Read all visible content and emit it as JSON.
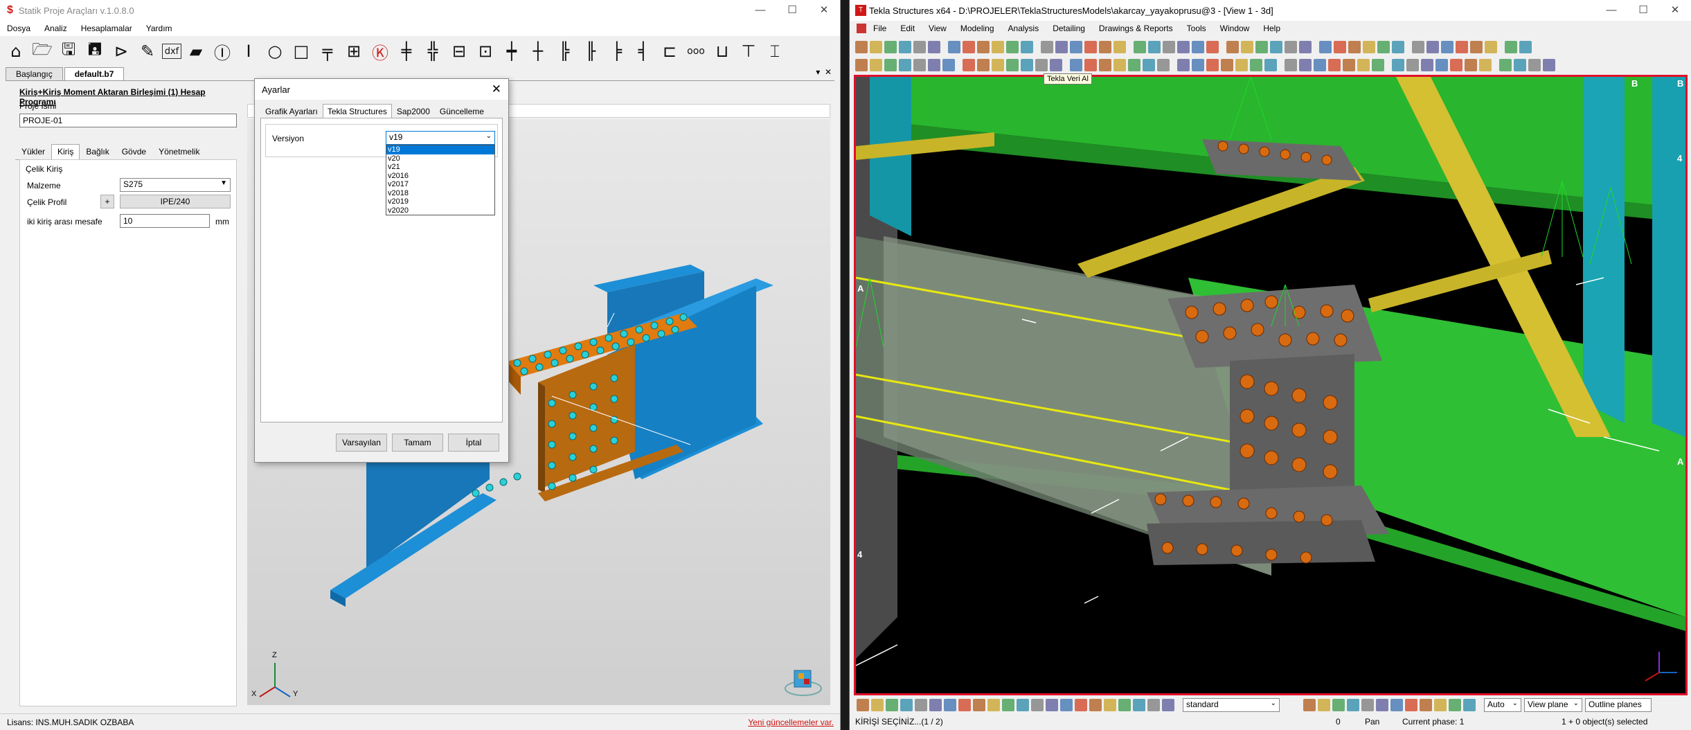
{
  "left_app": {
    "title": "Statik Proje Araçları v.1.0.8.0",
    "menu": [
      "Dosya",
      "Analiz",
      "Hesaplamalar",
      "Yardım"
    ],
    "doc_tabs": [
      "Başlangıç",
      "default.b7"
    ],
    "program_title": "Kiriş+Kiriş Moment Aktaran Birleşimi (1) Hesap Programı",
    "project_name_label": "Proje İsmi",
    "project_name_value": "PROJE-01",
    "tabs": [
      "Yükler",
      "Kiriş",
      "Bağlık",
      "Gövde",
      "Yönetmelik"
    ],
    "group_label": "Çelik Kiriş",
    "material_label": "Malzeme",
    "material_value": "S275",
    "profile_label": "Çelik Profil",
    "profile_plus": "+",
    "profile_value": "IPE/240",
    "distance_label": "iki kiriş arası mesafe",
    "distance_value": "10",
    "distance_unit": "mm",
    "license": "Lisans: INS.MUH.SADIK OZBABA",
    "update_link": "Yeni güncellemeler var.",
    "axes": {
      "z": "Z",
      "x": "X",
      "y": "Y"
    }
  },
  "dialog": {
    "title": "Ayarlar",
    "close": "✕",
    "tabs": [
      "Grafik Ayarları",
      "Tekla Structures",
      "Sap2000",
      "Güncelleme"
    ],
    "version_label": "Versiyon",
    "version_selected": "v19",
    "version_options": [
      "v19",
      "v20",
      "v21",
      "v2016",
      "v2017",
      "v2018",
      "v2019",
      "v2020"
    ],
    "buttons": {
      "defaults": "Varsayılan",
      "ok": "Tamam",
      "cancel": "İptal"
    }
  },
  "right_app": {
    "title": "Tekla Structures x64 - D:\\PROJELER\\TeklaStructuresModels\\akarcay_yayakoprusu@3 - [View 1 - 3d]",
    "menu": [
      "File",
      "Edit",
      "View",
      "Modeling",
      "Analysis",
      "Detailing",
      "Drawings & Reports",
      "Tools",
      "Window",
      "Help"
    ],
    "tooltip": "Tekla Veri Al",
    "grid_labels": {
      "a_left": "A",
      "a_right": "A",
      "b1": "B",
      "b2": "B",
      "four_left": "4",
      "four_right": "4"
    },
    "standard_combo": "standard",
    "auto_combo": "Auto",
    "view_plane_combo": "View plane",
    "outline_combo": "Outline planes",
    "status_prompt": "KİRİŞİ SEÇİNİZ...(1 / 2)",
    "status_zero": "0",
    "status_pan": "Pan",
    "status_phase": "Current phase: 1",
    "status_selected": "1 + 0 object(s) selected"
  }
}
